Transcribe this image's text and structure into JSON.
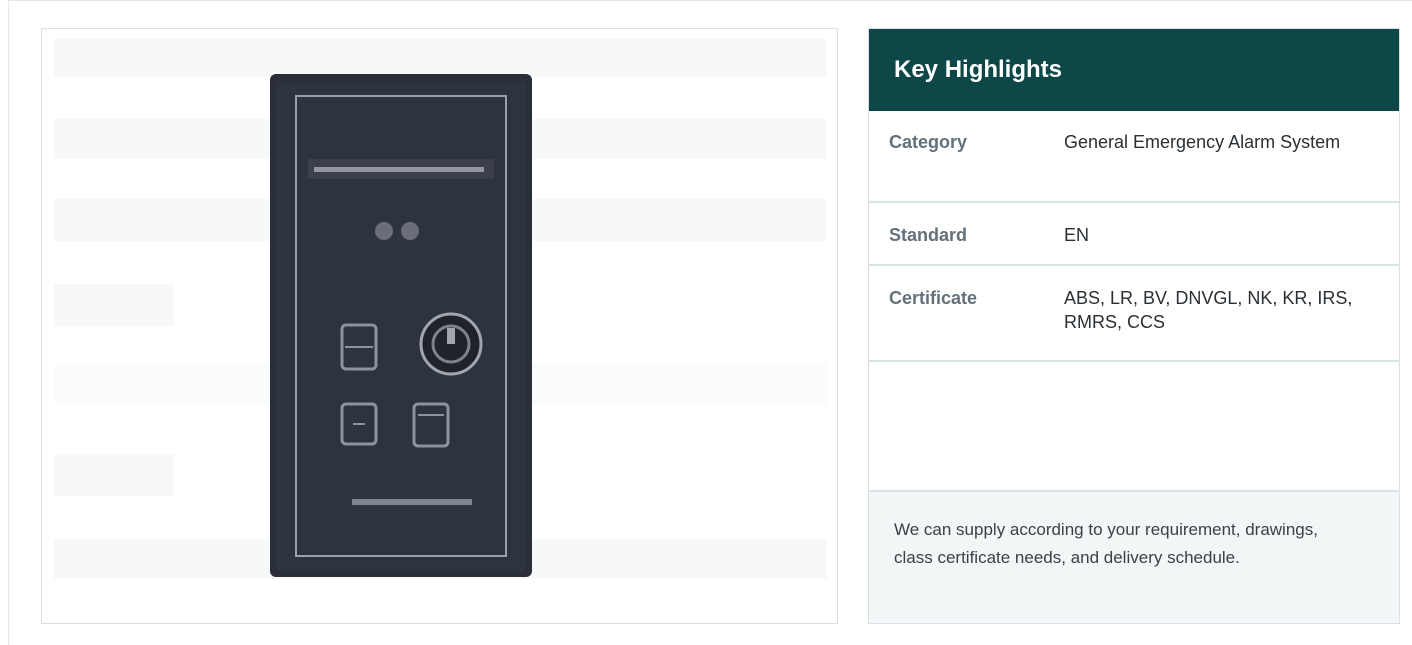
{
  "product_image": {
    "icon": "alarm-panel-image",
    "panel_color": "#2a2e38"
  },
  "highlights": {
    "title": "Key Highlights",
    "header_color": "#0e4747",
    "rows": [
      {
        "key": "Category",
        "value": "General Emergency Alarm System"
      },
      {
        "key": "Standard",
        "value": "EN"
      },
      {
        "key": "Certificate",
        "value": "ABS, LR, BV, DNVGL, NK, KR, IRS, RMRS, CCS"
      },
      {
        "key": "",
        "value": ""
      }
    ],
    "note": "We can supply according to your requirement, drawings, class certificate needs, and delivery schedule."
  }
}
